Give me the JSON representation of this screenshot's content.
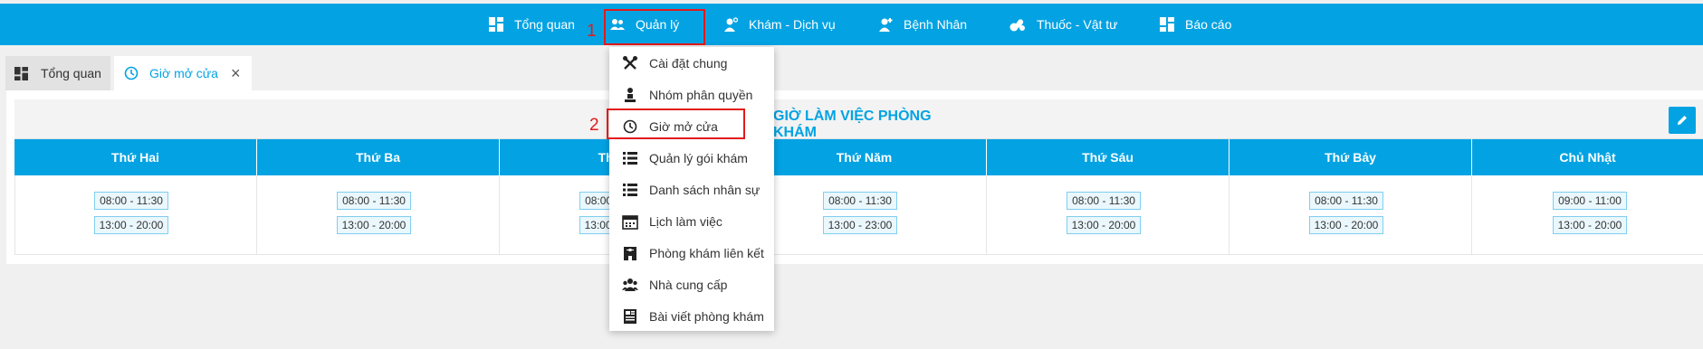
{
  "nav": {
    "items": [
      {
        "label": "Tổng quan",
        "icon": "dashboard-icon"
      },
      {
        "label": "Quản lý",
        "icon": "users-icon"
      },
      {
        "label": "Khám - Dịch vụ",
        "icon": "doctor-icon"
      },
      {
        "label": "Bệnh Nhân",
        "icon": "patient-icon"
      },
      {
        "label": "Thuốc - Vật tư",
        "icon": "medicine-icon"
      },
      {
        "label": "Báo cáo",
        "icon": "report-icon"
      }
    ]
  },
  "annotations": {
    "step1": "1",
    "step2": "2"
  },
  "tabs": [
    {
      "label": "Tổng quan",
      "icon": "dashboard-icon"
    },
    {
      "label": "Giờ mở cửa",
      "icon": "clock-icon",
      "close": "×"
    }
  ],
  "schedule": {
    "title": "GIỜ LÀM VIỆC PHÒNG KHÁM",
    "days": [
      {
        "name": "Thứ Hai",
        "slots": [
          "08:00 - 11:30",
          "13:00 - 20:00"
        ]
      },
      {
        "name": "Thứ Ba",
        "slots": [
          "08:00 - 11:30",
          "13:00 - 20:00"
        ]
      },
      {
        "name": "Thứ Tư",
        "slots": [
          "08:00 - 11:30",
          "13:00 - 20:00"
        ]
      },
      {
        "name": "Thứ Năm",
        "slots": [
          "08:00 - 11:30",
          "13:00 - 23:00"
        ]
      },
      {
        "name": "Thứ Sáu",
        "slots": [
          "08:00 - 11:30",
          "13:00 - 20:00"
        ]
      },
      {
        "name": "Thứ Bảy",
        "slots": [
          "08:00 - 11:30",
          "13:00 - 20:00"
        ]
      },
      {
        "name": "Chủ Nhật",
        "slots": [
          "09:00 - 11:00",
          "13:00 - 20:00"
        ]
      }
    ]
  },
  "dropdown": {
    "items": [
      {
        "label": "Cài đặt chung",
        "icon": "tools-icon"
      },
      {
        "label": "Nhóm phân quyền",
        "icon": "group-permission-icon"
      },
      {
        "label": "Giờ mở cửa",
        "icon": "clock-icon"
      },
      {
        "label": "Quản lý gói khám",
        "icon": "list-icon"
      },
      {
        "label": "Danh sách nhân sự",
        "icon": "list-icon"
      },
      {
        "label": "Lịch làm việc",
        "icon": "calendar-icon"
      },
      {
        "label": "Phòng khám liên kết",
        "icon": "building-icon"
      },
      {
        "label": "Nhà cung cấp",
        "icon": "supplier-icon"
      },
      {
        "label": "Bài viết phòng khám",
        "icon": "article-icon"
      }
    ]
  },
  "colors": {
    "accent": "#03a3e3",
    "highlight": "#e31a1a"
  }
}
